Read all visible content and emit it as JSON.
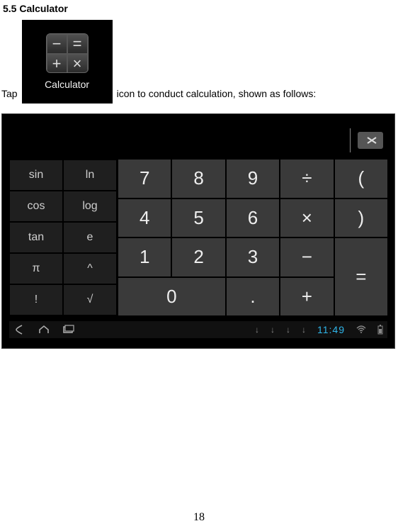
{
  "section_title": "5.5 Calculator",
  "intro_before": "Tap",
  "intro_after": "icon to conduct calculation, shown as follows:",
  "calc_icon": {
    "cells": {
      "tl": "−",
      "tr": "=",
      "bl": "+",
      "br": "×"
    },
    "label": "Calculator"
  },
  "backspace": {
    "glyph": "×"
  },
  "sci_keys": {
    "r0c0": "sin",
    "r0c1": "ln",
    "r1c0": "cos",
    "r1c1": "log",
    "r2c0": "tan",
    "r2c1": "e",
    "r3c0": "π",
    "r3c1": "^",
    "r4c0": "!",
    "r4c1": "√"
  },
  "num_keys": {
    "k7": "7",
    "k8": "8",
    "k9": "9",
    "div": "÷",
    "lpar": "(",
    "k4": "4",
    "k5": "5",
    "k6": "6",
    "mul": "×",
    "rpar": ")",
    "k1": "1",
    "k2": "2",
    "k3": "3",
    "sub": "−",
    "k0": "0",
    "dot": ".",
    "add": "+",
    "eq": "="
  },
  "statusbar": {
    "time": "11:49",
    "down_glyph": "↓"
  },
  "page_number": "18"
}
